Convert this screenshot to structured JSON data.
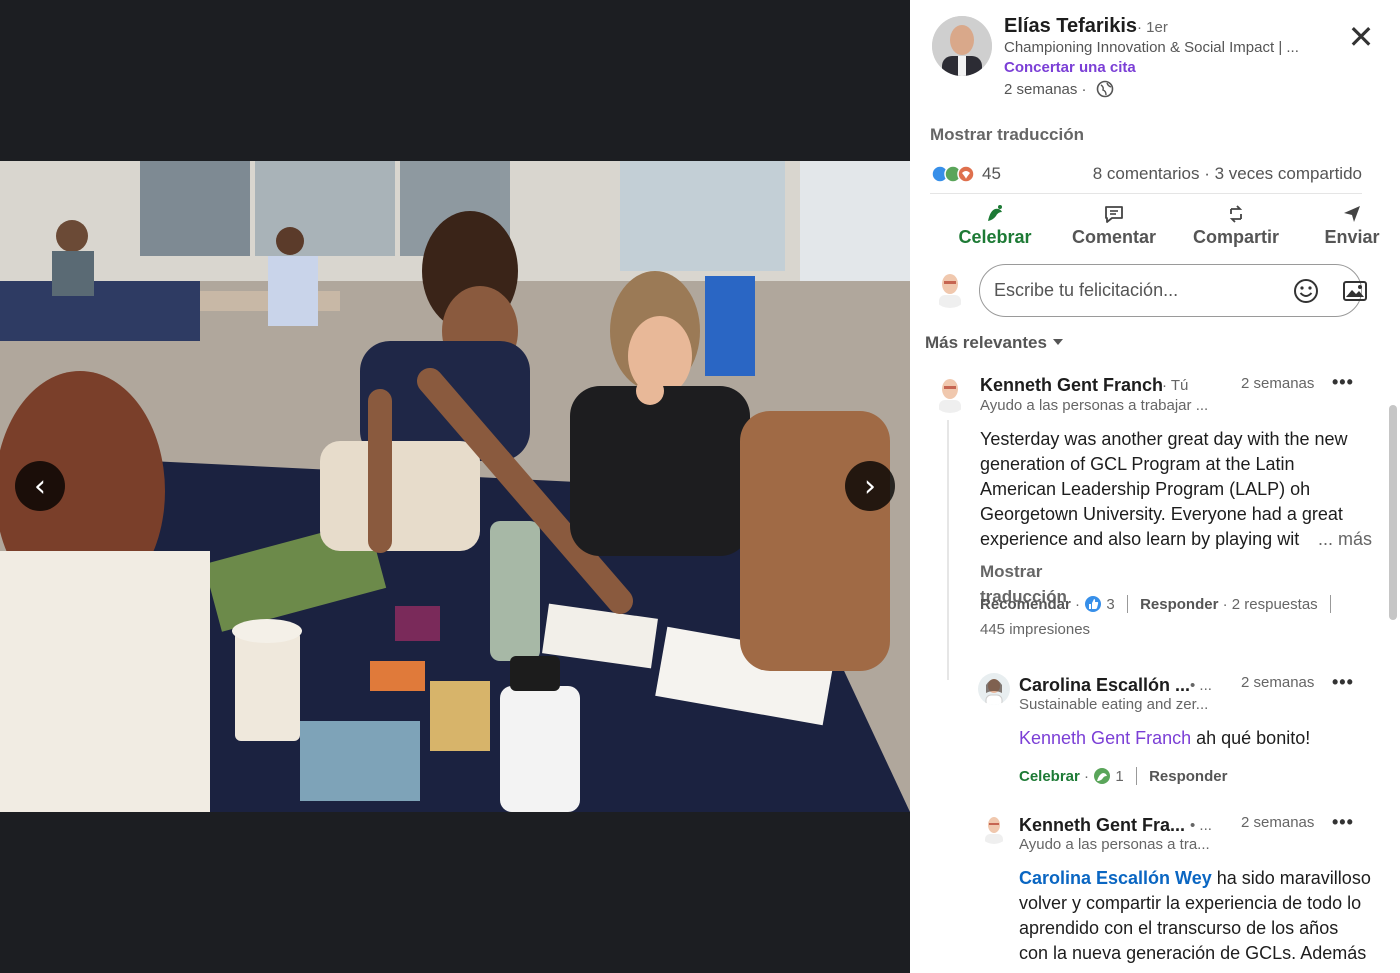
{
  "viewer": {
    "prev_glyph": "‹",
    "next_glyph": "›"
  },
  "post": {
    "author": "Elías Tefarikis",
    "degree": "· 1er",
    "headline": "Championing Innovation & Social Impact | ...",
    "cta": "Concertar una cita",
    "time": "2 semanas ·",
    "close_glyph": "✕",
    "show_translation": "Mostrar traducción",
    "reaction_count": "45",
    "meta": "8 comentarios · 3 veces compartido"
  },
  "actions": [
    {
      "label": "Celebrar",
      "icon": "celebrate-icon"
    },
    {
      "label": "Comentar",
      "icon": "comment-icon"
    },
    {
      "label": "Compartir",
      "icon": "repost-icon"
    },
    {
      "label": "Enviar",
      "icon": "send-icon"
    }
  ],
  "compose": {
    "placeholder": "Escribe tu felicitación..."
  },
  "sort": {
    "label": "Más relevantes"
  },
  "comments": [
    {
      "name": "Kenneth Gent Franch",
      "badge": "· Tú",
      "time": "2 semanas",
      "more": "•••",
      "headline": "Ayudo a las personas a trabajar ...",
      "text": "Yesterday was another great day with the new generation of GCL Program at the Latin American Leadership Program (LALP) oh Georgetown University. Everyone had a great experience and also learn by playing wit",
      "see_more": "... más",
      "show_translation": "Mostrar traducción",
      "like": "Recomendar",
      "like_count": "3",
      "reply": "Responder",
      "replies": "· 2 respuestas",
      "impressions": "445 impresiones"
    },
    {
      "name": "Carolina Escallón ...",
      "badge": "• ...",
      "time": "2 semanas",
      "more": "•••",
      "headline": "Sustainable eating and zer...",
      "mention": "Kenneth Gent Franch",
      "text": " ah qué bonito!",
      "like": "Celebrar",
      "like_count": "1",
      "reply": "Responder"
    },
    {
      "name": "Kenneth Gent Fra...",
      "badge": "• ...",
      "time": "2 semanas",
      "more": "•••",
      "headline": "Ayudo a las personas a tra...",
      "mention": "Carolina Escallón Wey",
      "text": " ha sido maravilloso volver y compartir la experiencia de todo lo aprendido con el transcurso de los años con la nueva generación de GCLs. Además"
    }
  ],
  "colors": {
    "celebrate_green": "#1d7a35",
    "link_purple": "#7b3fd6",
    "mention_blue": "#0a66c2"
  }
}
